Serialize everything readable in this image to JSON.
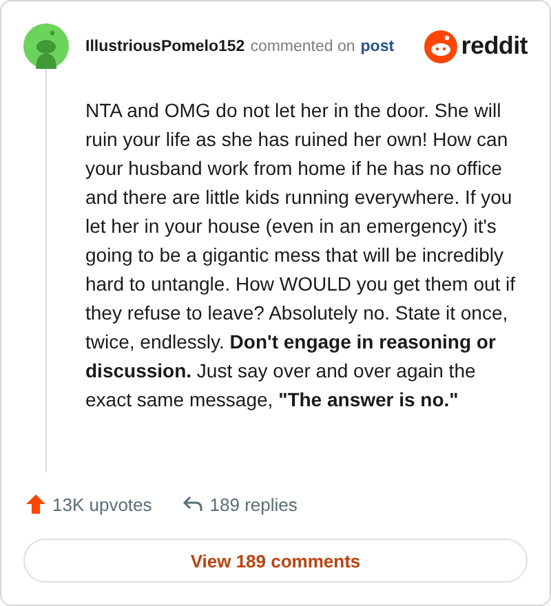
{
  "comment": {
    "author": "IllustriousPomelo152",
    "action": "commented on",
    "link": "post",
    "brand": "reddit",
    "body": "NTA and OMG do not let her in the door. She will ruin your life as she has ruined her own! How can your husband work from home if he has no office and there are little kids running everywhere. If you let her in your house (even in an emergency) it's going to be a gigantic mess that will be incredibly hard to untangle. How WOULD you get them out if they refuse to leave? Absolutely no. State it once, twice, endlessly. **Don't engage in reasoning or discussion.** Just say over and over again the exact same message, **\"The answer is no.\"**"
  },
  "stats": {
    "upvotes": "13K upvotes",
    "replies": "189 replies"
  },
  "button": "View 189 comments"
}
